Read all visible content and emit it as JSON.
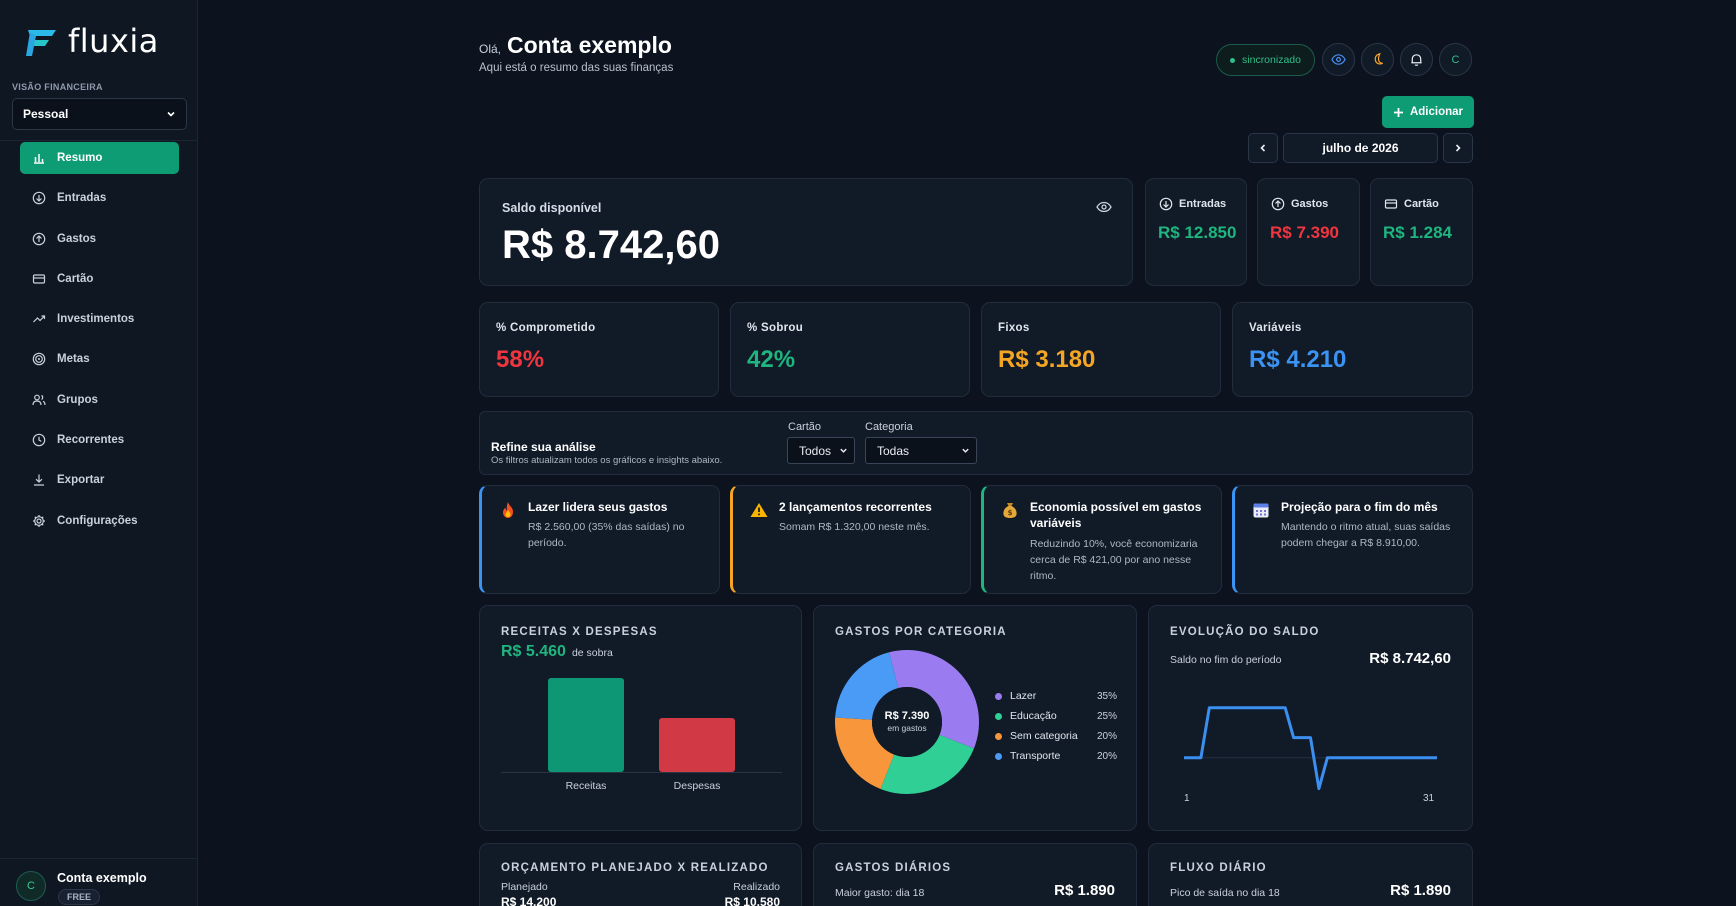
{
  "sidebar": {
    "logo": "fluxia",
    "vision_label": "VISÃO FINANCEIRA",
    "vision_select": "Pessoal",
    "nav": [
      {
        "label": "Resumo",
        "icon": "bar-chart-icon"
      },
      {
        "label": "Entradas",
        "icon": "arrow-down-circle-icon"
      },
      {
        "label": "Gastos",
        "icon": "arrow-up-circle-icon"
      },
      {
        "label": "Cartão",
        "icon": "credit-card-icon"
      },
      {
        "label": "Investimentos",
        "icon": "trending-up-icon"
      },
      {
        "label": "Metas",
        "icon": "target-icon"
      },
      {
        "label": "Grupos",
        "icon": "users-icon"
      },
      {
        "label": "Recorrentes",
        "icon": "clock-icon"
      },
      {
        "label": "Exportar",
        "icon": "download-icon"
      },
      {
        "label": "Configurações",
        "icon": "gear-icon"
      }
    ],
    "account": {
      "avatar": "C",
      "name": "Conta exemplo",
      "plan": "FREE"
    }
  },
  "header": {
    "greeting": "Olá,",
    "name": "Conta exemplo",
    "subtitle": "Aqui está o resumo das suas finanças",
    "sync": "sincronizado",
    "user_initial": "C",
    "add_label": "Adicionar",
    "month": "julho de 2026"
  },
  "saldo": {
    "label": "Saldo disponível",
    "value": "R$ 8.742,60"
  },
  "mini": {
    "entradas": {
      "label": "Entradas",
      "value": "R$ 12.850"
    },
    "gastos": {
      "label": "Gastos",
      "value": "R$ 7.390"
    },
    "cartao": {
      "label": "Cartão",
      "value": "R$ 1.284"
    }
  },
  "stats": [
    {
      "label": "% Comprometido",
      "value": "58%"
    },
    {
      "label": "% Sobrou",
      "value": "42%"
    },
    {
      "label": "Fixos",
      "value": "R$ 3.180"
    },
    {
      "label": "Variáveis",
      "value": "R$ 4.210"
    }
  ],
  "filters": {
    "title": "Refine sua análise",
    "subtitle": "Os filtros atualizam todos os gráficos e insights abaixo.",
    "card_label": "Cartão",
    "card_value": "Todos",
    "category_label": "Categoria",
    "category_value": "Todas"
  },
  "insights": [
    {
      "icon": "fire-icon",
      "title": "Lazer lidera seus gastos",
      "text": "R$ 2.560,00 (35% das saídas) no período.",
      "color": "#3b93f3"
    },
    {
      "icon": "warning-icon",
      "title": "2 lançamentos recorrentes",
      "text": "Somam R$ 1.320,00 neste mês.",
      "color": "#f5a524"
    },
    {
      "icon": "money-bag-icon",
      "title": "Economia possível em gastos variáveis",
      "text": "Reduzindo 10%, você economizaria cerca de R$ 421,00 por ano nesse ritmo.",
      "color": "#1fb57f"
    },
    {
      "icon": "calendar-icon",
      "title": "Projeção para o fim do mês",
      "text": "Mantendo o ritmo atual, suas saídas podem chegar a R$ 8.910,00.",
      "color": "#3b93f3"
    }
  ],
  "receitas": {
    "title": "RECEITAS X DESPESAS",
    "sobra_value": "R$ 5.460",
    "sobra_label": "de sobra"
  },
  "gastos_categoria": {
    "title": "GASTOS POR CATEGORIA",
    "center_value": "R$ 7.390",
    "center_label": "em gastos"
  },
  "evolucao": {
    "title": "EVOLUÇÃO DO SALDO",
    "subtitle": "Saldo no fim do período",
    "value": "R$ 8.742,60",
    "x_start": "1",
    "x_end": "31"
  },
  "orcamento": {
    "title": "ORÇAMENTO PLANEJADO X REALIZADO",
    "planned_label": "Planejado",
    "planned_value": "R$ 14.200",
    "realized_label": "Realizado",
    "realized_value": "R$ 10.580"
  },
  "gastos_diarios": {
    "title": "GASTOS DIÁRIOS",
    "subtitle": "Maior gasto: dia 18",
    "value": "R$ 1.890"
  },
  "fluxo_diario": {
    "title": "FLUXO DIÁRIO",
    "subtitle": "Pico de saída no dia 18",
    "value": "R$ 1.890"
  },
  "chart_data": [
    {
      "type": "bar",
      "categories": [
        "Receitas",
        "Despesas"
      ],
      "values": [
        12850,
        7390
      ],
      "colors": [
        "#0e9774",
        "#d13a45"
      ]
    },
    {
      "type": "pie",
      "categories": [
        "Lazer",
        "Educação",
        "Sem categoria",
        "Transporte"
      ],
      "values": [
        35,
        25,
        20,
        20
      ],
      "colors": [
        "#9a7cf0",
        "#2fcf96",
        "#f7963a",
        "#4a9bf5"
      ]
    },
    {
      "type": "line",
      "x": [
        1,
        2,
        3,
        4,
        5,
        6,
        7,
        8,
        9,
        10,
        11,
        12,
        13,
        14,
        15,
        16,
        17,
        18,
        19,
        20,
        21,
        22,
        23,
        24,
        25,
        26,
        27,
        28,
        29,
        30,
        31
      ],
      "y": [
        8742,
        8742,
        8742,
        12850,
        12850,
        12850,
        12850,
        12850,
        12850,
        12850,
        12850,
        12850,
        12850,
        10400,
        10400,
        10400,
        6200,
        8742,
        8742,
        8742,
        8742,
        8742,
        8742,
        8742,
        8742,
        8742,
        8742,
        8742,
        8742,
        8742,
        8742
      ],
      "color": "#3b8ff0"
    }
  ]
}
